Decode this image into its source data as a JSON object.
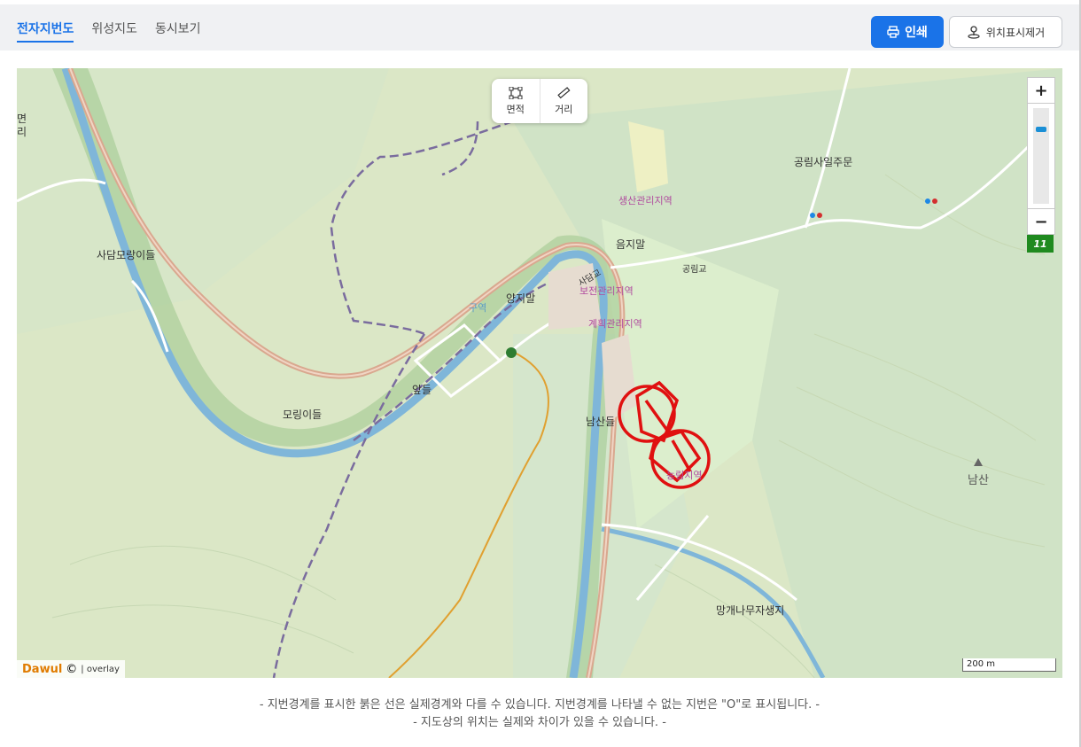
{
  "tabs": [
    {
      "label": "전자지번도",
      "active": true
    },
    {
      "label": "위성지도",
      "active": false
    },
    {
      "label": "동시보기",
      "active": false
    }
  ],
  "toolbar": {
    "print_label": "인쇄",
    "clear_location_label": "위치표시제거"
  },
  "map": {
    "measure_tools": {
      "area_label": "면적",
      "distance_label": "거리"
    },
    "zoom": {
      "in_label": "+",
      "out_label": "−",
      "level": 11
    },
    "place_labels": {
      "sadam_morang": "사담모랑이들",
      "moring": "모링이들",
      "apdeul": "앞들",
      "yangjimal": "양지말",
      "eumjimal": "음지말",
      "namsandeul": "남산들",
      "gongrim_office": "공림사일주문",
      "mangae_tree": "망개나무자생지",
      "namsan": "남산",
      "sadamgyo": "사담교",
      "gongrimgyo": "공림교",
      "cut_left_1": "면",
      "cut_left_2": "리",
      "cut_zone": "구역"
    },
    "zone_labels": {
      "production": "생산관리지역",
      "conservation": "보전관리지역",
      "planning": "계획관리지역",
      "forest": "농림지역"
    },
    "logo_brand": "Dawul",
    "logo_overlay": "| overlay",
    "scale_label": "200 m",
    "colors": {
      "water": "#7fb6d9",
      "river_green": "#8fc28a",
      "road_main": "#d9a88f",
      "marker": "#e01010"
    }
  },
  "notice": {
    "line1": "- 지번경계를 표시한 붉은 선은 실제경계와 다를 수 있습니다. 지번경계를 나타낼 수 없는 지번은 \"O\"로 표시됩니다. -",
    "line2": "- 지도상의 위치는 실제와 차이가 있을 수 있습니다. -"
  }
}
